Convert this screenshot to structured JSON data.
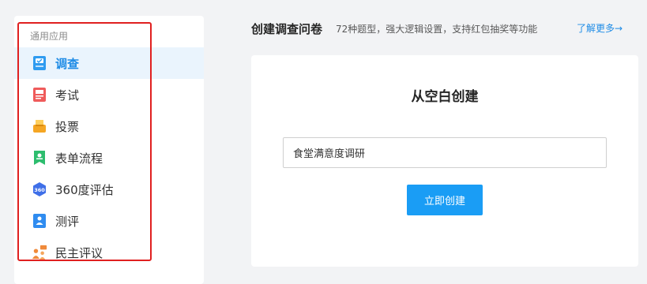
{
  "sidebar": {
    "section_label": "通用应用",
    "items": [
      {
        "label": "调查",
        "icon": "survey-icon",
        "active": true
      },
      {
        "label": "考试",
        "icon": "exam-icon"
      },
      {
        "label": "投票",
        "icon": "vote-icon"
      },
      {
        "label": "表单流程",
        "icon": "form-flow-icon"
      },
      {
        "label": "360度评估",
        "icon": "360-eval-icon"
      },
      {
        "label": "测评",
        "icon": "assessment-icon"
      },
      {
        "label": "民主评议",
        "icon": "democratic-review-icon"
      }
    ]
  },
  "header": {
    "title": "创建调查问卷",
    "description": "72种题型，强大逻辑设置，支持红包抽奖等功能",
    "link": "了解更多→"
  },
  "card": {
    "title": "从空白创建",
    "input_value": "食堂满意度调研",
    "create_button": "立即创建"
  },
  "colors": {
    "accent": "#1f8ce6",
    "button": "#1a9df5",
    "highlight_border": "#e02020",
    "active_bg": "#eaf4fd"
  }
}
